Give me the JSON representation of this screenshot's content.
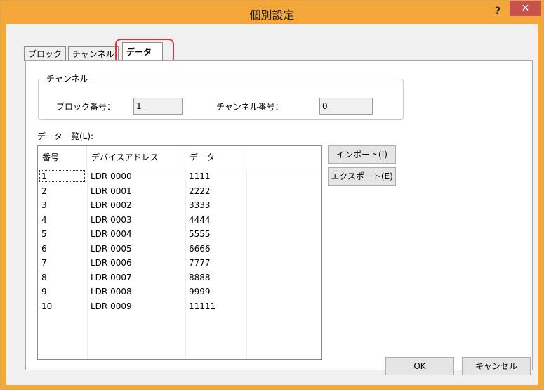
{
  "window": {
    "title": "個別設定",
    "help": "?",
    "close": "✕"
  },
  "tabs": [
    {
      "label": "ブロック"
    },
    {
      "label": "チャンネル"
    },
    {
      "label": "データ"
    }
  ],
  "channel_group": {
    "legend": "チャンネル",
    "block_label": "ブロック番号：",
    "block_value": "1",
    "channel_label": "チャンネル番号：",
    "channel_value": "0"
  },
  "data_list": {
    "label": "データ一覧(L):",
    "columns": [
      "番号",
      "デバイスアドレス",
      "データ"
    ],
    "rows": [
      [
        "1",
        "LDR 0000",
        "1111"
      ],
      [
        "2",
        "LDR 0001",
        "2222"
      ],
      [
        "3",
        "LDR 0002",
        "3333"
      ],
      [
        "4",
        "LDR 0003",
        "4444"
      ],
      [
        "5",
        "LDR 0004",
        "5555"
      ],
      [
        "6",
        "LDR 0005",
        "6666"
      ],
      [
        "7",
        "LDR 0006",
        "7777"
      ],
      [
        "8",
        "LDR 0007",
        "8888"
      ],
      [
        "9",
        "LDR 0008",
        "9999"
      ],
      [
        "10",
        "LDR 0009",
        "11111"
      ]
    ]
  },
  "buttons": {
    "import": "インポート(I)",
    "export": "エクスポート(E)",
    "ok": "OK",
    "cancel": "キャンセル"
  },
  "colors": {
    "title_bar": "#f3a73b",
    "close_button": "#c7514b",
    "highlight": "#e0303a"
  }
}
